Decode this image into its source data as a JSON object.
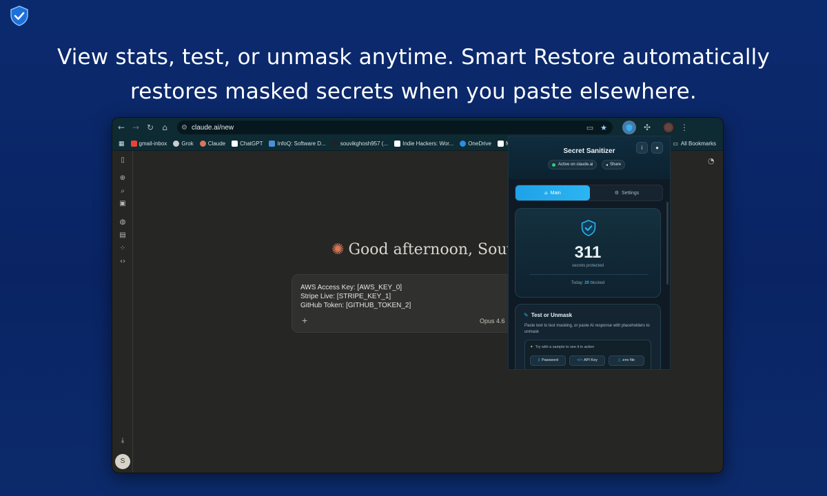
{
  "headline": {
    "line1": "View stats, test, or unmask anytime. Smart Restore automatically",
    "line2": "restores masked secrets when you paste elsewhere."
  },
  "browser": {
    "url": "claude.ai/new",
    "bookmarks": [
      {
        "label": "gmail-inbox",
        "color": "#ea4335"
      },
      {
        "label": "Grok",
        "color": "#cccccc"
      },
      {
        "label": "Claude",
        "color": "#d97757"
      },
      {
        "label": "ChatGPT",
        "color": "#ffffff"
      },
      {
        "label": "InfoQ: Software D...",
        "color": "#4a90d9"
      },
      {
        "label": "souvikghosh957 (...",
        "color": "#222222"
      },
      {
        "label": "Indie Hackers: Wor...",
        "color": "#ffffff"
      },
      {
        "label": "OneDrive",
        "color": "#2a8fe0"
      },
      {
        "label": "M",
        "color": "#ffffff"
      }
    ],
    "all_bookmarks": "All Bookmarks"
  },
  "claude": {
    "greeting": "Good afternoon, Souv",
    "input_lines": [
      "AWS Access Key: [AWS_KEY_0]",
      "Stripe Live: [STRIPE_KEY_1]",
      "GitHub Token: [GITHUB_TOKEN_2]"
    ],
    "model": "Opus 4.6",
    "user_initial": "S"
  },
  "popup": {
    "title": "Secret Sanitizer",
    "info_btn": "i",
    "status": "Active on claude.ai",
    "share": "Share",
    "tabs": {
      "main": "Main",
      "settings": "Settings"
    },
    "stats": {
      "count": "311",
      "label": "secrets protected",
      "today_prefix": "Today:",
      "today_count": "20",
      "today_suffix": "blocked"
    },
    "test": {
      "title": "Test or Unmask",
      "desc": "Paste text to test masking, or paste AI response with placeholders to unmask",
      "hint": "Try with a sample to see it in action",
      "chips": [
        "Password",
        "API Key",
        ".env file"
      ]
    }
  },
  "colors": {
    "accent": "#2cb5f2",
    "background": "#0a2463",
    "claude_star": "#d97757",
    "status_green": "#2ad07a"
  }
}
